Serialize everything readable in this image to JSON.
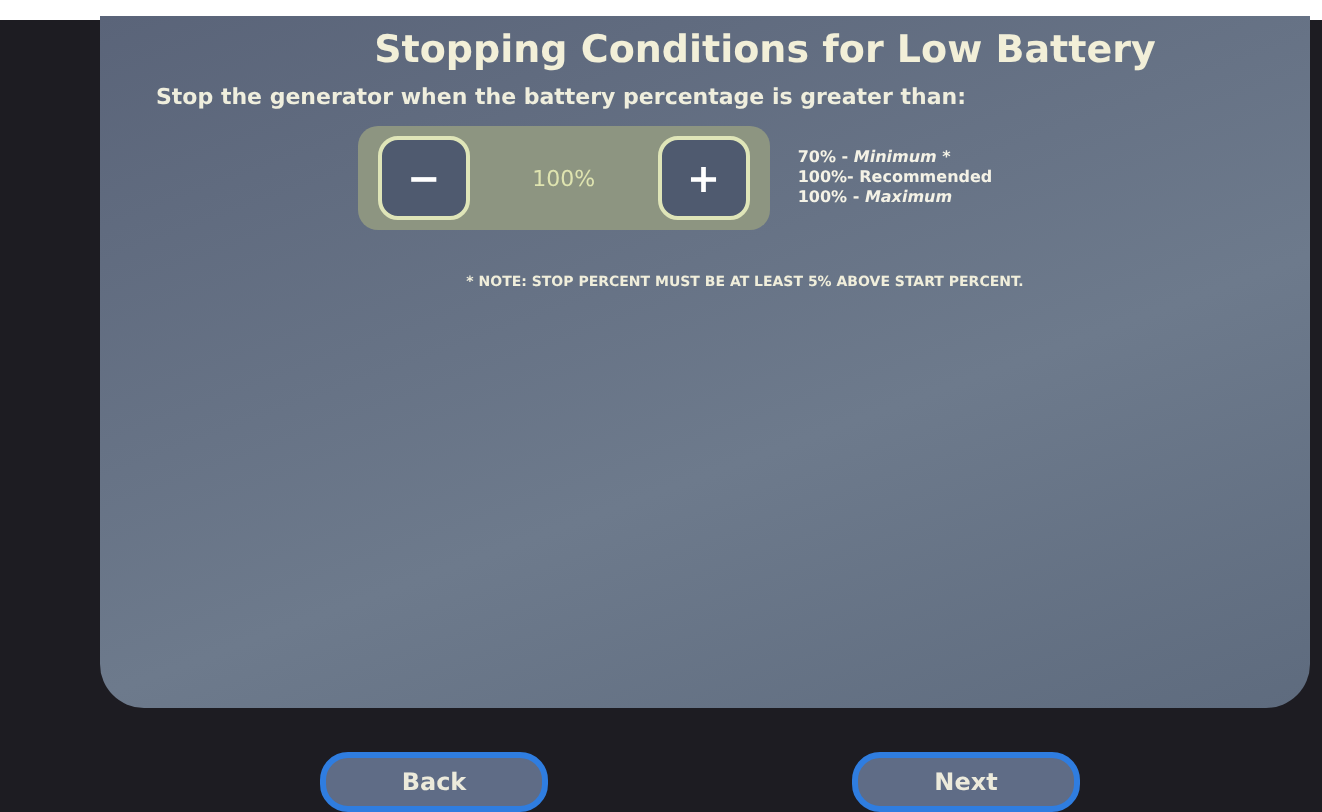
{
  "title": "Stopping Conditions for Low Battery",
  "prompt": "Stop the generator when the battery percentage is greater than:",
  "stepper": {
    "decrement": "−",
    "value": "100%",
    "increment": "+"
  },
  "limits": [
    "70% - *Minimum* *",
    "100%- Recommended",
    "100% - *Maximum*"
  ],
  "note": "* NOTE: STOP PERCENT MUST BE AT LEAST 5% ABOVE START PERCENT.",
  "buttons": [
    {
      "label": "Back"
    },
    {
      "label": "Next"
    }
  ]
}
